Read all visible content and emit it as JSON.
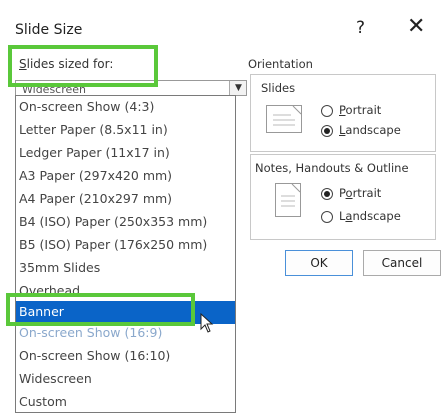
{
  "dialog": {
    "title": "Slide Size",
    "help": "?",
    "close": "✕"
  },
  "slides_sized_for": {
    "label_accel": "S",
    "label_rest": "lides sized for:",
    "combo_value": "Widescreen",
    "options": [
      "On-screen Show (4:3)",
      "Letter Paper (8.5x11 in)",
      "Ledger Paper (11x17 in)",
      "A3 Paper (297x420 mm)",
      "A4 Paper (210x297 mm)",
      "B4 (ISO) Paper (250x353 mm)",
      "B5 (ISO) Paper (176x250 mm)",
      "35mm Slides",
      "Overhead",
      "Banner",
      "On-screen Show (16:9)",
      "On-screen Show (16:10)",
      "Widescreen",
      "Custom"
    ],
    "selected": "Banner"
  },
  "orientation": {
    "title": "Orientation",
    "slides": {
      "title": "Slides",
      "portrait_accel": "P",
      "portrait_rest": "ortrait",
      "landscape_accel": "L",
      "landscape_rest": "andscape",
      "selected": "Landscape"
    },
    "notes": {
      "title": "Notes, Handouts & Outline",
      "portrait_pre": "P",
      "portrait_accel": "o",
      "portrait_rest": "rtrait",
      "landscape_pre": "L",
      "landscape_accel": "a",
      "landscape_rest": "ndscape",
      "selected": "Portrait"
    }
  },
  "buttons": {
    "ok": "OK",
    "cancel": "Cancel"
  }
}
